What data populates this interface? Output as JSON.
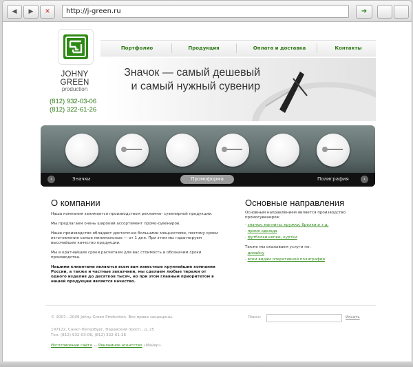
{
  "browser": {
    "back_icon": "◀",
    "forward_icon": "▶",
    "stop_icon": "✕",
    "go_icon": "➜",
    "url": "http://j-green.ru"
  },
  "site": {
    "brand": {
      "name": "JOHNY GREEN",
      "tagline": "production"
    },
    "phones": [
      "(812) 932-03-06",
      "(812) 322-61-26"
    ],
    "menu": [
      "Портфолио",
      "Продукция",
      "Оплата и доставка",
      "Контакты"
    ],
    "hero": {
      "line1": "Значок — самый дешевый",
      "line2": "и самый нужный сувенир"
    },
    "carousel": {
      "left_label": "Значки",
      "active_label": "Промоформа",
      "right_label": "Полиграфия",
      "prev": "‹",
      "next": "›"
    },
    "about": {
      "title": "О компании",
      "paragraphs": [
        "Наша компания занимается производством рекламно- сувенирной продукции.",
        "Мы предлагаем очень широкий ассортимент промо-сувениров.",
        "Наше производство обладает достаточно большими мощностями, поэтому сроки изготовления самые минимальные — от 1 дня. При этом мы гарантируем высочайшее качество продукции.",
        "Мы в кратчайшие сроки расчитаем для вас стоимость и обозначим сроки производства."
      ],
      "strong_paragraph": "Нашими клиентами являются всем вам известные крупнейшие компании России, а также и частные заказчики, мы сделаем любые тиражи от одного изделия до десятков тысяч, но при этом главным приоритетом в нашей продукции является качество."
    },
    "directions": {
      "title": "Основные направления",
      "intro": "Основным направлением является производство промосувениров:",
      "items": [
        "значки, магниты, кружки, брелки и т.д.",
        "промо одежда",
        "футболки,кепки, куртки"
      ],
      "also_intro": "Также мы оказываем услуги по:",
      "also_items": [
        "дизайну",
        "всем видам оперативной полиграфии"
      ]
    },
    "footer": {
      "copyright": "© 2007—2009 Johny Green Production. Все права защищены.",
      "address": "197122, Санкт-Петербург, Наравский просп., д. 25",
      "phones": "Тел. (812) 932-03-06, (812) 322-61-26",
      "made_link": "Изготовление сайта",
      "made_dash": " — ",
      "agency_link": "Рекламное агентство",
      "agency_name": " «Майер».",
      "search_label": "Поиск:",
      "search_button": "Искать"
    }
  },
  "colors": {
    "accent": "#2e7a16",
    "dark": "#2d3434"
  }
}
